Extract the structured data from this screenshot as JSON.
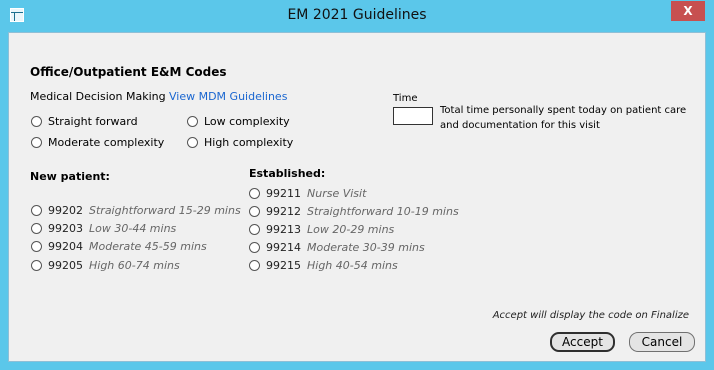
{
  "window": {
    "title": "EM 2021 Guidelines",
    "close_label": "X"
  },
  "heading": "Office/Outpatient E&M Codes",
  "mdm": {
    "label": "Medical Decision Making",
    "link": "View MDM Guidelines",
    "options": [
      "Straight forward",
      "Low complexity",
      "Moderate complexity",
      "High complexity"
    ]
  },
  "time": {
    "label": "Time",
    "value": "",
    "description_line1": "Total time personally spent today on patient care",
    "description_line2": "and documentation for this visit"
  },
  "new_patient": {
    "label": "New patient:",
    "codes": [
      {
        "code": "99202",
        "desc": "Straightforward 15-29 mins"
      },
      {
        "code": "99203",
        "desc": "Low 30-44 mins"
      },
      {
        "code": "99204",
        "desc": "Moderate 45-59 mins"
      },
      {
        "code": "99205",
        "desc": "High 60-74 mins"
      }
    ]
  },
  "established": {
    "label": "Established:",
    "codes": [
      {
        "code": "99211",
        "desc": "Nurse Visit"
      },
      {
        "code": "99212",
        "desc": "Straightforward 10-19 mins"
      },
      {
        "code": "99213",
        "desc": "Low 20-29 mins"
      },
      {
        "code": "99214",
        "desc": "Moderate 30-39 mins"
      },
      {
        "code": "99215",
        "desc": "High 40-54 mins"
      }
    ]
  },
  "footer": {
    "note": "Accept will display the code on Finalize",
    "accept_label": "Accept",
    "cancel_label": "Cancel"
  }
}
